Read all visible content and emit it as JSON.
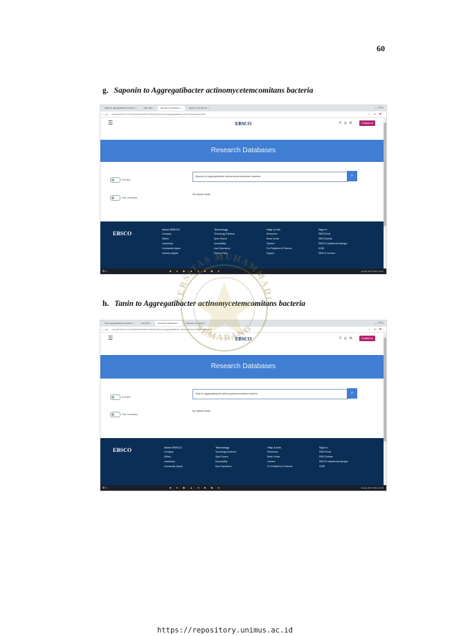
{
  "page_number": "60",
  "footer_url": "https://repository.unimus.ac.id",
  "watermark": {
    "text_top": "UNIVERSITAS MUHAMMADIYAH",
    "text_bottom": "SEMARANG"
  },
  "figures": [
    {
      "label": "g.",
      "caption": "Saponin to Aggregatibacter actinomycetemcomitans bacteria",
      "tabs": [
        "Saponin aggregatibacter actinom",
        "New Tab",
        "Research Databases",
        "Saponin and Tannin"
      ],
      "url": "research.ebsco.com/c/ntgcbm/search/results?q=saponin+to+aggregatibacter+actinomycetemcomitans",
      "logo": "EBSCO",
      "contact_label": "Contact us",
      "banner": "Research Databases",
      "side_items": [
        "Full text",
        "Peer reviewed"
      ],
      "search_value": "Saponin to Aggregatibacter actinomycetemcomitans bacteria",
      "results_text": "No results found",
      "footer": {
        "logo": "EBSCO",
        "columns": [
          {
            "heading": "About EBSCO",
            "items": [
              "Company",
              "Offices",
              "Leadership",
              "Community Impact",
              "Industry Insights"
            ]
          },
          {
            "heading": "Technology",
            "items": [
              "Technology Solutions",
              "Open Source",
              "Accessibility",
              "User Experience",
              "Privacy Policy"
            ]
          },
          {
            "heading": "Help & Info",
            "items": [
              "Resources",
              "News Center",
              "Careers",
              "For Publishers & Partners",
              "Support"
            ]
          },
          {
            "heading": "Sign In",
            "items": [
              "EBSCOhost",
              "EBSCOadmin",
              "EBSCO Institutional Manager",
              "GOBI",
              "EBSCO Connect"
            ]
          }
        ]
      },
      "taskbar": {
        "left": "⊞ ⌕",
        "right": "Cloudy 26°C  ENG  13:47"
      }
    },
    {
      "label": "h.",
      "caption": "Tanin to Aggregatibacter actinomycetemcomitans bacteria",
      "tabs": [
        "Tanin aggregatibacter actinom",
        "New Tab",
        "Research Databases",
        "Saponin and Tannin"
      ],
      "url": "research.ebsco.com/c/ntgcbm/search/results?q=tanin+to+aggregatibacter+actinomycetemcomitans+bacteria",
      "logo": "EBSCO",
      "contact_label": "Contact us",
      "banner": "Research Databases",
      "side_items": [
        "Full text",
        "Peer reviewed"
      ],
      "search_value": "Tanin to Aggregatibacter actinomycetemcomitans bacteria",
      "results_text": "No results found",
      "footer": {
        "logo": "EBSCO",
        "columns": [
          {
            "heading": "About EBSCO",
            "items": [
              "Company",
              "Offices",
              "Leadership",
              "Community Impact"
            ]
          },
          {
            "heading": "Technology",
            "items": [
              "Technology Solutions",
              "Open Source",
              "Accessibility",
              "User Experience"
            ]
          },
          {
            "heading": "Help & Info",
            "items": [
              "Resources",
              "News Center",
              "Careers",
              "For Publishers & Partners"
            ]
          },
          {
            "heading": "Sign In",
            "items": [
              "EBSCOhost",
              "EBSCOadmin",
              "EBSCO Institutional Manager",
              "GOBI"
            ]
          }
        ]
      },
      "taskbar": {
        "left": "⊞ ⌕",
        "right": "Cloudy 26°C  ENG  13:48"
      }
    }
  ]
}
